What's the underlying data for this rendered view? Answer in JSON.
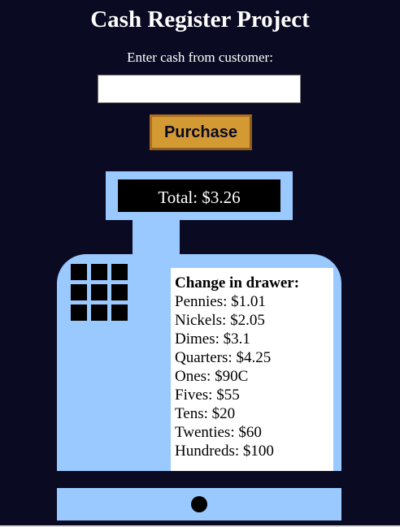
{
  "header": {
    "title": "Cash Register Project"
  },
  "form": {
    "input_label": "Enter cash from customer:",
    "input_value": "",
    "purchase_label": "Purchase"
  },
  "register": {
    "total_text": "Total: $3.26",
    "drawer": {
      "heading": "Change in drawer:",
      "lines": [
        "Pennies: $1.01",
        "Nickels: $2.05",
        "Dimes: $3.1",
        "Quarters: $4.25",
        "Ones: $90C",
        "Fives: $55",
        "Tens: $20",
        "Twenties: $60",
        "Hundreds: $100"
      ]
    }
  },
  "colors": {
    "background": "#0a0a23",
    "register": "#99c9ff",
    "button": "#d39a34",
    "screen": "#000000"
  }
}
